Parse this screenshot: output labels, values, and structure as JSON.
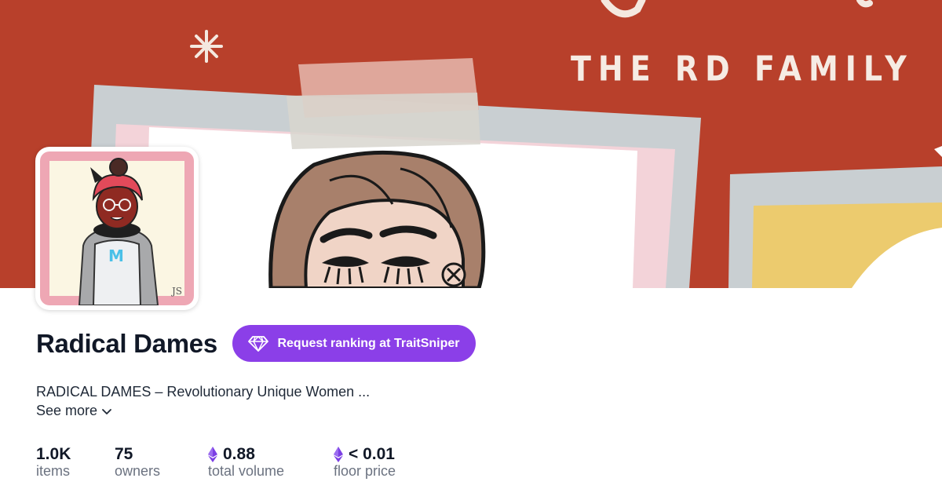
{
  "banner": {
    "title": "THE RD FAMILY"
  },
  "collection": {
    "name": "Radical Dames",
    "description": "RADICAL DAMES – Revolutionary Unique Women ...",
    "see_more_label": "See more"
  },
  "rank_button": {
    "label": "Request ranking at TraitSniper",
    "icon": "diamond-icon"
  },
  "stats": [
    {
      "value": "1.0K",
      "label": "items",
      "eth": false
    },
    {
      "value": "75",
      "label": "owners",
      "eth": false
    },
    {
      "value": "0.88",
      "label": "total volume",
      "eth": true
    },
    {
      "value": "< 0.01",
      "label": "floor price",
      "eth": true
    }
  ],
  "colors": {
    "banner_bg": "#b8402b",
    "accent_purple": "#8b3fe8",
    "eth_purple": "#7b3fe4",
    "muted_text": "#6b7280"
  }
}
